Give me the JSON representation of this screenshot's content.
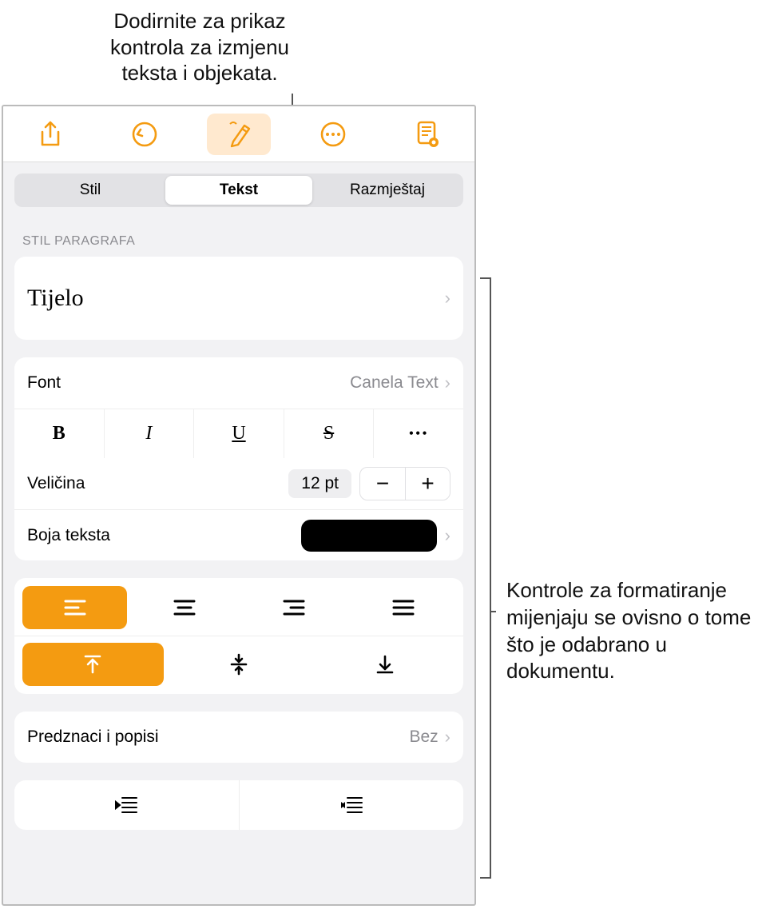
{
  "callouts": {
    "top": "Dodirnite za prikaz kontrola za izmjenu teksta i objekata.",
    "right": "Kontrole za formatiranje mijenjaju se ovisno o tome što je odabrano u dokumentu."
  },
  "tabs": {
    "style": "Stil",
    "text": "Tekst",
    "layout": "Razmještaj"
  },
  "sections": {
    "paragraph_style_label": "STIL PARAGRAFA"
  },
  "paragraph_style": {
    "value": "Tijelo"
  },
  "font": {
    "label": "Font",
    "value": "Canela Text"
  },
  "style_buttons": {
    "bold": "B",
    "italic": "I",
    "underline": "U",
    "strike": "S",
    "more": "•••"
  },
  "size": {
    "label": "Veličina",
    "value": "12 pt",
    "decrease": "−",
    "increase": "+"
  },
  "text_color": {
    "label": "Boja teksta",
    "value": "#000000"
  },
  "bullets": {
    "label": "Predznaci i popisi",
    "value": "Bez"
  }
}
